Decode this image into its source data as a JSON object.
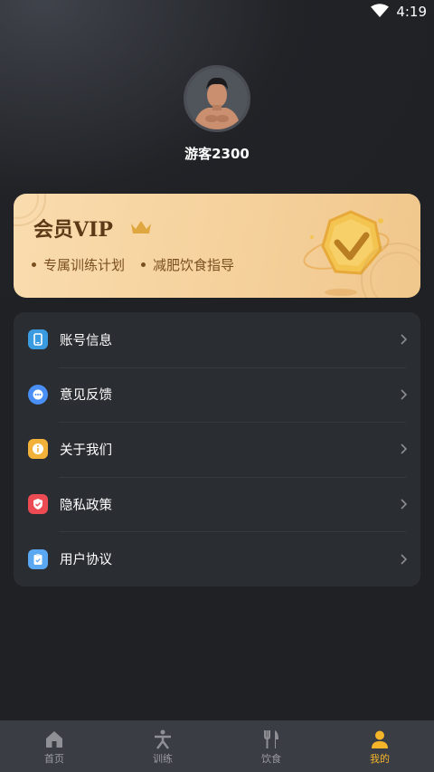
{
  "status_bar": {
    "time": "4:19"
  },
  "profile": {
    "nickname": "游客2300"
  },
  "vip": {
    "title": "会员VIP",
    "benefits": [
      "专属训练计划",
      "减肥饮食指导"
    ]
  },
  "menu": {
    "items": [
      {
        "label": "账号信息",
        "icon": "phone-icon",
        "color": "#3a9be0"
      },
      {
        "label": "意见反馈",
        "icon": "chat-icon",
        "color": "#4a8ff5"
      },
      {
        "label": "关于我们",
        "icon": "info-icon",
        "color": "#f2b23a"
      },
      {
        "label": "隐私政策",
        "icon": "shield-icon",
        "color": "#ec4b53"
      },
      {
        "label": "用户协议",
        "icon": "clipboard-icon",
        "color": "#5aa7f2"
      }
    ]
  },
  "tabbar": {
    "tabs": [
      {
        "label": "首页",
        "icon": "home-icon"
      },
      {
        "label": "训练",
        "icon": "training-icon"
      },
      {
        "label": "饮食",
        "icon": "fork-knife-icon"
      },
      {
        "label": "我的",
        "icon": "person-icon",
        "active": true
      }
    ]
  },
  "colors": {
    "accent": "#f5b52a",
    "background": "#1f2125",
    "card": "#2a2d32"
  }
}
